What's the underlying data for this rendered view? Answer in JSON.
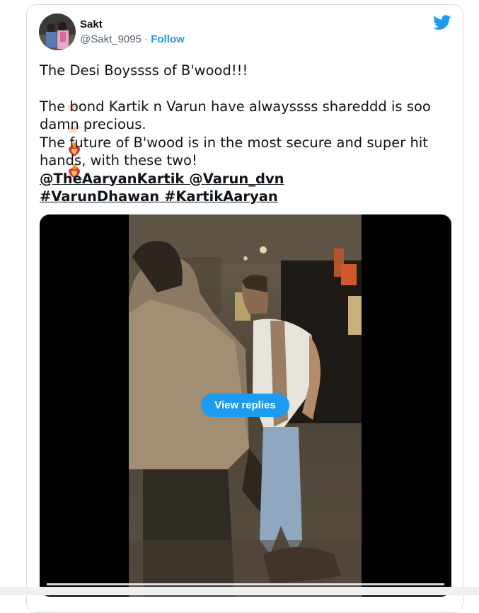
{
  "author": {
    "display_name": "Sakt",
    "handle": "@Sakt_9095",
    "separator": " · ",
    "follow_label": "Follow"
  },
  "tweet": {
    "line1": "The Desi Boyssss of B'wood!!!",
    "emojis": [
      "index-pointing-icon",
      "index-pointing-icon",
      "heart-on-fire-icon",
      "heart-on-fire-icon"
    ],
    "line2": "The bond Kartik n Varun have alwayssss shareddd is soo damn precious.",
    "line3": "The future of B'wood is in the most secure and super hit hands, with these two!",
    "mentions": [
      "@TheAaryanKartik",
      "@Varun_dvn"
    ],
    "hashtags": [
      "#VarunDhawan",
      "#KartikAaryan"
    ]
  },
  "media": {
    "view_replies_label": "View replies"
  },
  "colors": {
    "accent": "#1d9bf0",
    "text": "#0f1419",
    "muted": "#536471"
  }
}
